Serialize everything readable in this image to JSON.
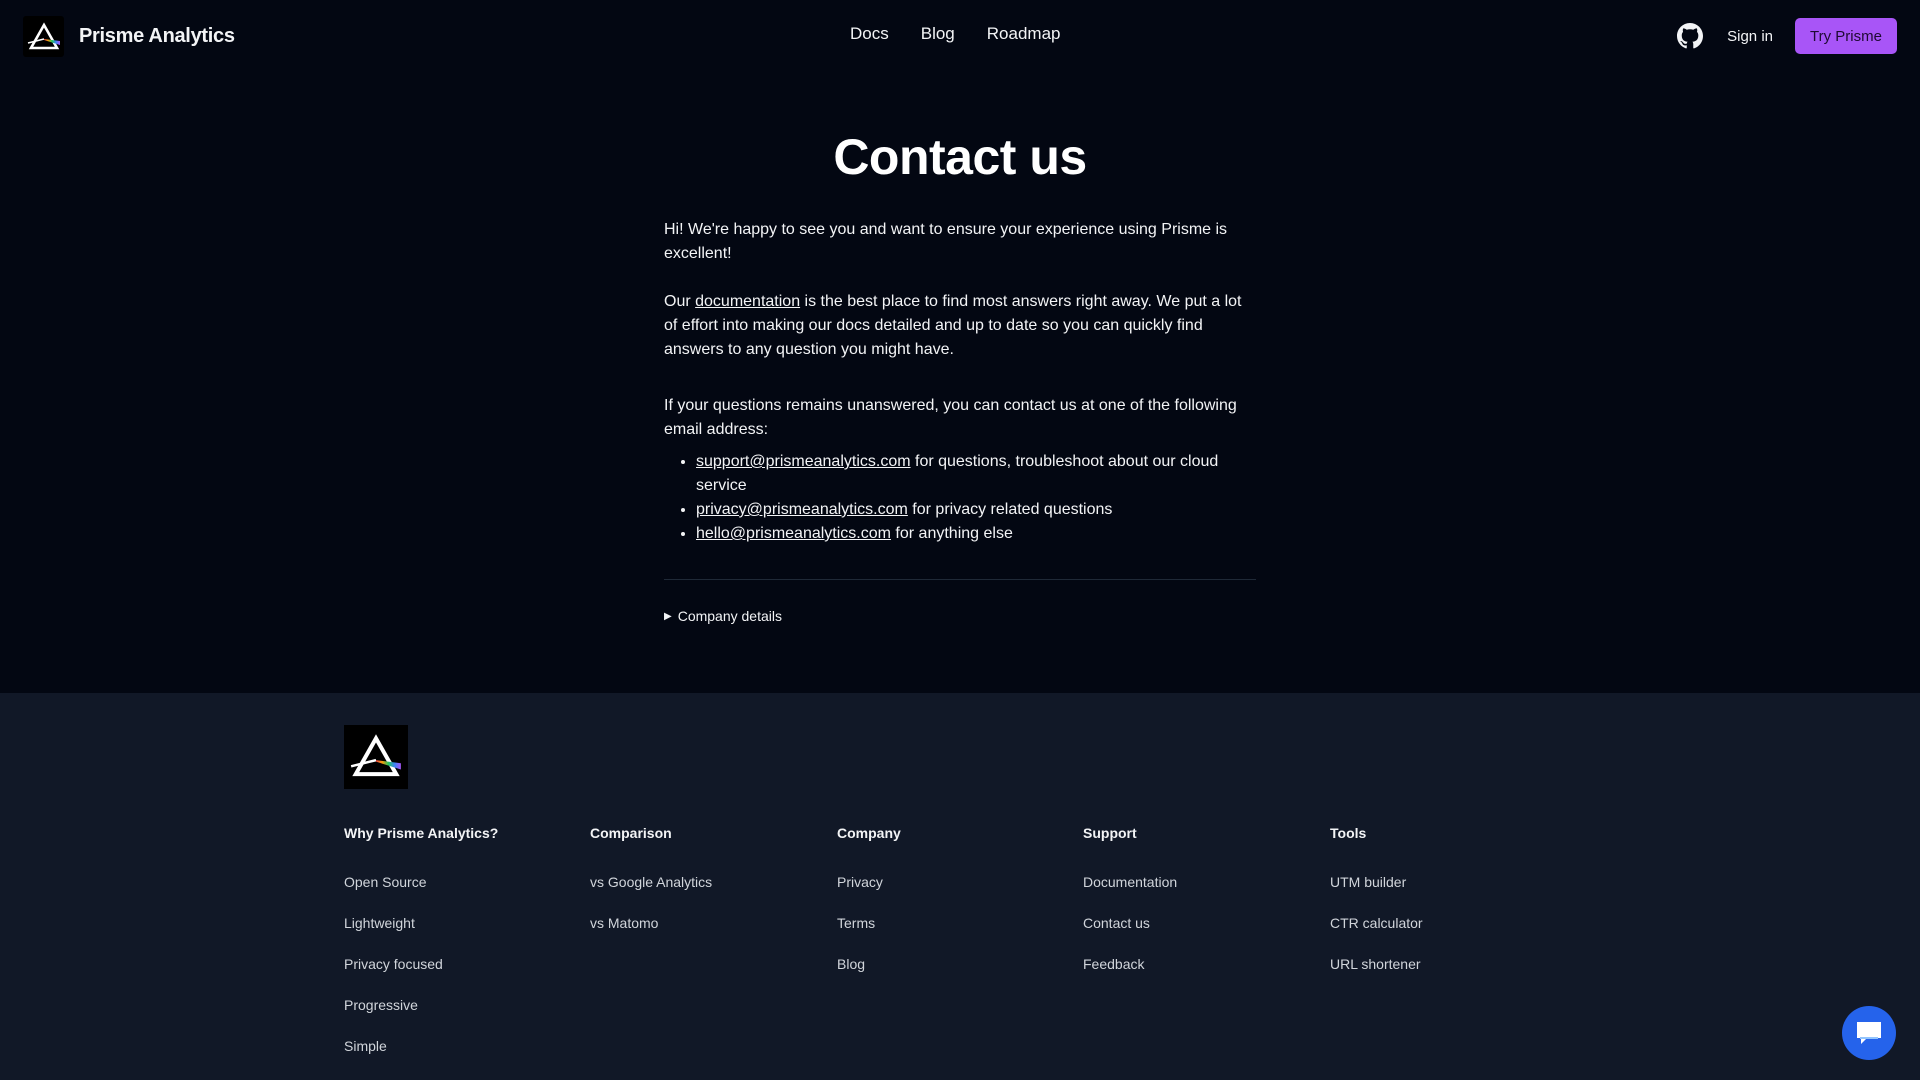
{
  "header": {
    "brand_name": "Prisme Analytics",
    "nav": [
      "Docs",
      "Blog",
      "Roadmap"
    ],
    "github_icon": "github-icon",
    "sign_in": "Sign in",
    "cta": "Try Prisme"
  },
  "main": {
    "title": "Contact us",
    "intro": "Hi! We're happy to see you and want to ensure your experience using Prisme is excellent!",
    "docs_prefix": "Our ",
    "docs_link": "documentation",
    "docs_suffix": " is the best place to find most answers right away. We put a lot of effort into making our docs detailed and up to date so you can quickly find answers to any question you might have.",
    "contact_intro": "If your questions remains unanswered, you can contact us at one of the following email address:",
    "emails": [
      {
        "address": "support@prismeanalytics.com",
        "desc": " for questions, troubleshoot about our cloud service"
      },
      {
        "address": "privacy@prismeanalytics.com",
        "desc": " for privacy related questions"
      },
      {
        "address": "hello@prismeanalytics.com",
        "desc": " for anything else"
      }
    ],
    "details_summary": "Company details"
  },
  "footer": {
    "columns": [
      {
        "title": "Why Prisme Analytics?",
        "links": [
          "Open Source",
          "Lightweight",
          "Privacy focused",
          "Progressive",
          "Simple"
        ]
      },
      {
        "title": "Comparison",
        "links": [
          "vs Google Analytics",
          "vs Matomo"
        ]
      },
      {
        "title": "Company",
        "links": [
          "Privacy",
          "Terms",
          "Blog"
        ]
      },
      {
        "title": "Support",
        "links": [
          "Documentation",
          "Contact us",
          "Feedback"
        ]
      },
      {
        "title": "Tools",
        "links": [
          "UTM builder",
          "CTR calculator",
          "URL shortener"
        ]
      }
    ]
  },
  "colors": {
    "background": "#030712",
    "footer_background": "#111827",
    "accent": "#a855f7",
    "chat_button": "#2563eb"
  },
  "icons": {
    "chat": "chat-bubble-icon",
    "logo": "prism-logo-icon"
  }
}
